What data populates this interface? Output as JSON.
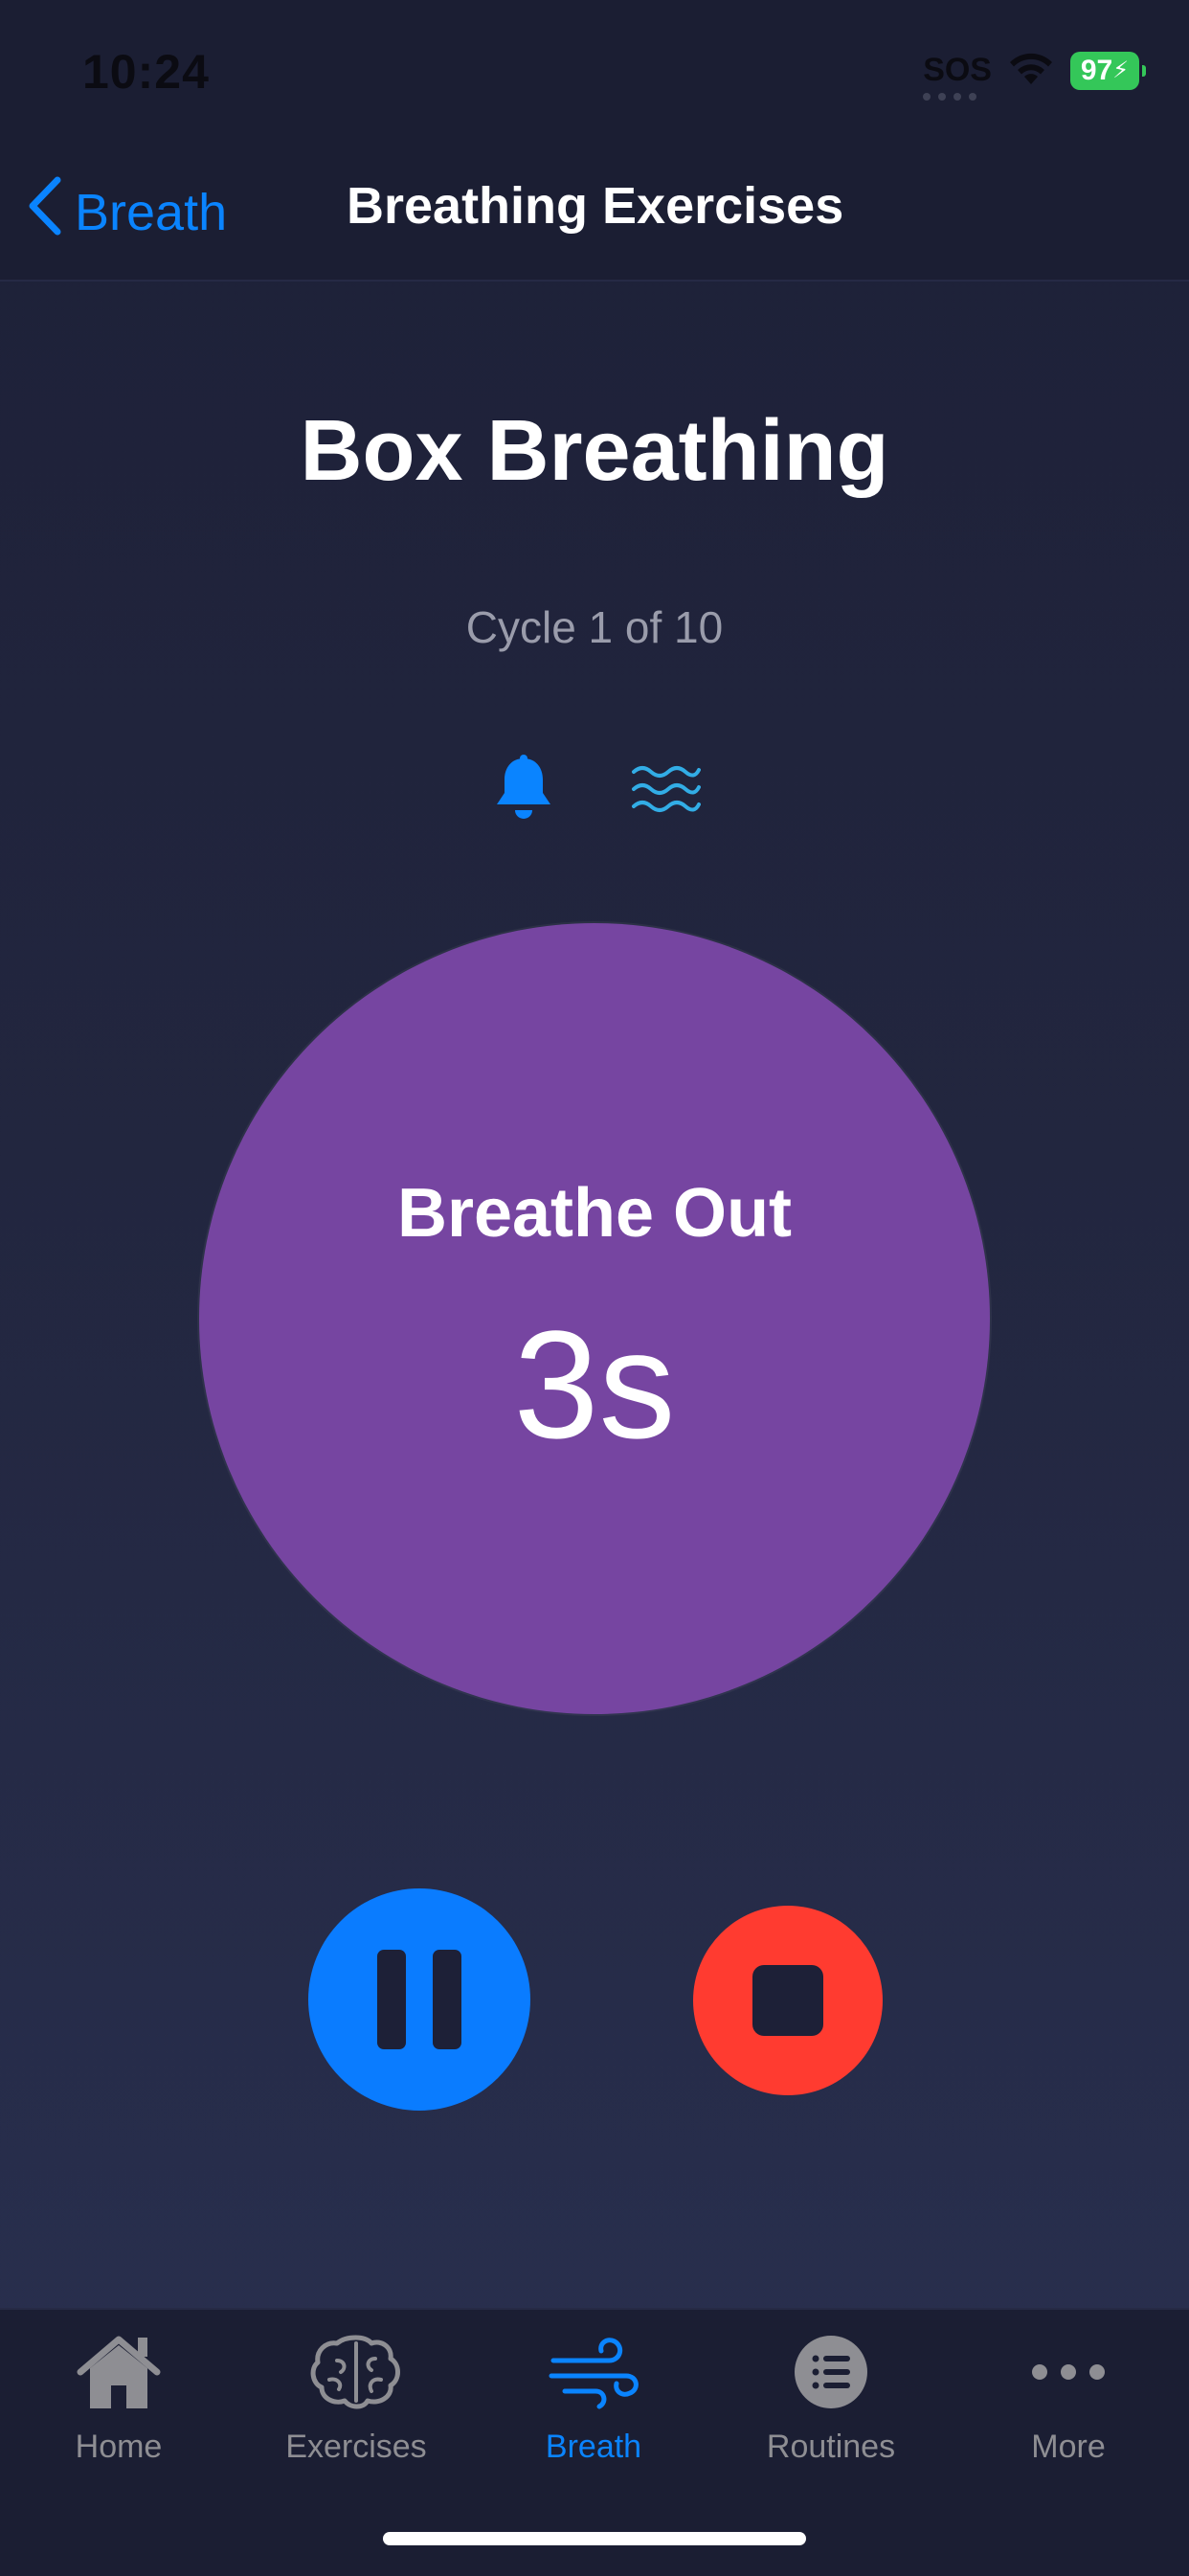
{
  "status_bar": {
    "time": "10:24",
    "carrier": "SOS",
    "battery": "97"
  },
  "nav": {
    "back_label": "Breath",
    "title": "Breathing Exercises"
  },
  "exercise": {
    "title": "Box Breathing",
    "cycle": "Cycle 1 of 10",
    "phase": "Breathe Out",
    "countdown": "3s"
  },
  "icons": {
    "sound": "bell-icon",
    "haptics": "waves-icon",
    "pause": "pause-icon",
    "stop": "stop-icon"
  },
  "tabs": [
    {
      "label": "Home",
      "icon": "house-icon",
      "active": false
    },
    {
      "label": "Exercises",
      "icon": "brain-icon",
      "active": false
    },
    {
      "label": "Breath",
      "icon": "wind-icon",
      "active": true
    },
    {
      "label": "Routines",
      "icon": "list-icon",
      "active": false
    },
    {
      "label": "More",
      "icon": "ellipsis-icon",
      "active": false
    }
  ],
  "colors": {
    "accent": "#0a84ff",
    "circle": "#7645a1",
    "stop": "#ff3b30",
    "battery": "#34c759",
    "inactive_tab": "#8e8e93"
  }
}
